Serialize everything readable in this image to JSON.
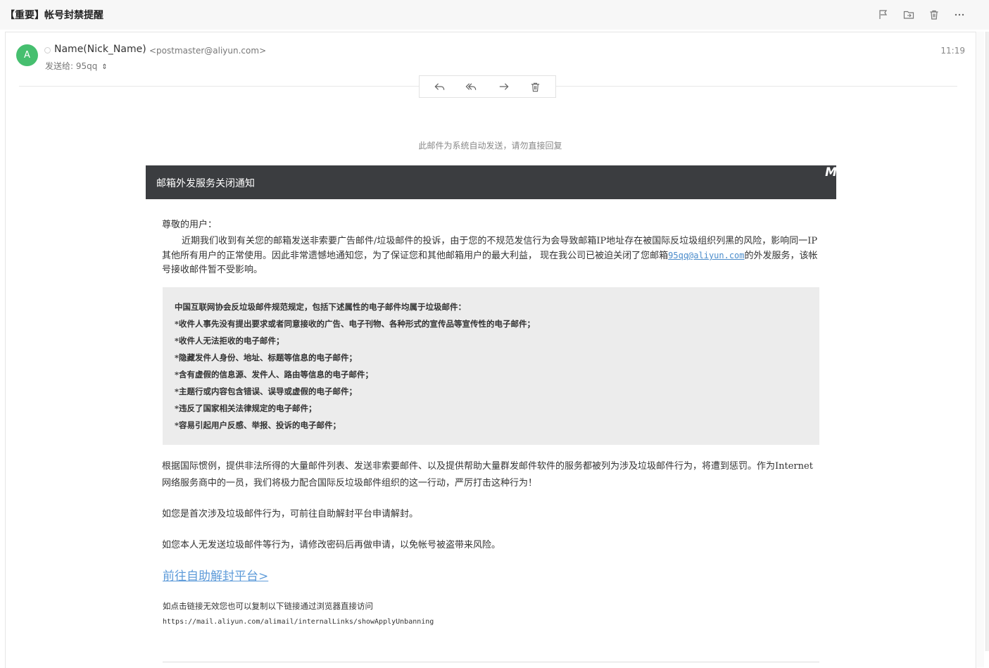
{
  "subject": "【重要】帐号封禁提醒",
  "toolbar": {
    "icons": [
      "flag-icon",
      "move-folder-icon",
      "trash-icon",
      "more-icon"
    ]
  },
  "sender": {
    "avatar_letter": "A",
    "avatar_color": "#46bf6f",
    "name": "Name(Nick_Name)",
    "email": "<postmaster@aliyun.com>",
    "time": "11:19",
    "to_label": "发送给: 95qq"
  },
  "actions": [
    "reply-icon",
    "reply-all-icon",
    "forward-icon",
    "delete-icon"
  ],
  "auto_note": "此邮件为系统自动发送，请勿直接回复",
  "banner": {
    "title": "邮箱外发服务关闭通知",
    "logo": "M",
    "bg_color": "#3b3d40"
  },
  "body": {
    "greeting": "尊敬的用户：",
    "para1_before": "近期我们收到有关您的邮箱发送非索要广告邮件/垃圾邮件的投诉，由于您的不规范发信行为会导致邮箱IP地址存在被国际反垃圾组织列黑的风险，影响同一IP其他所有用户的正常使用。因此非常遗憾地通知您，为了保证您和其他邮箱用户的最大利益， 现在我公司已被迫关闭了您邮箱",
    "para1_link": "95qq@aliyun.com",
    "para1_after": "的外发服务，该帐号接收邮件暂不受影响。",
    "rules": [
      "中国互联网协会反垃圾邮件规范规定，包括下述属性的电子邮件均属于垃圾邮件：",
      "*收件人事先没有提出要求或者同意接收的广告、电子刊物、各种形式的宣传品等宣传性的电子邮件；",
      "*收件人无法拒收的电子邮件；",
      "*隐藏发件人身份、地址、标题等信息的电子邮件；",
      "*含有虚假的信息源、发件人、路由等信息的电子邮件；",
      "*主题行或内容包含错误、误导或虚假的电子邮件；",
      "*违反了国家相关法律规定的电子邮件；",
      "*容易引起用户反感、举报、投诉的电子邮件；"
    ],
    "para2": "根据国际惯例，提供非法所得的大量邮件列表、发送非索要邮件、以及提供帮助大量群发邮件软件的服务都被列为涉及垃圾邮件行为，将遭到惩罚。作为Internet网络服务商中的一员，我们将极力配合国际反垃圾邮件组织的这一行动，严厉打击这种行为！",
    "para3": "如您是首次涉及垃圾邮件行为，可前往自助解封平台申请解封。",
    "para4": "如您本人无发送垃圾邮件等行为，请修改密码后再做申请，以免帐号被盗带来风险。",
    "link_text": "前往自助解封平台>",
    "hint": "如点击链接无效您也可以复制以下链接通过浏览器直接访问",
    "url": "https://mail.aliyun.com/alimail/internalLinks/showApplyUnbanning"
  }
}
